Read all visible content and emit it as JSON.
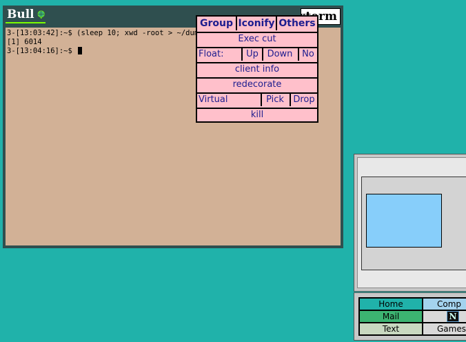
{
  "xterm": {
    "logo_text": "Bull",
    "title": "xterm",
    "lines": [
      "3-[13:03:42]:~$ (sleep 10; xwd -root > ~/dump/",
      "[1] 6014",
      "3-[13:04:16]:~$ "
    ]
  },
  "window_menu": {
    "group": "Group",
    "iconify": "Iconify",
    "others": "Others",
    "exec_cut": "Exec cut",
    "float_label": "Float:",
    "float_up": "Up",
    "float_down": "Down",
    "float_no": "No",
    "client_info": "client info",
    "redecorate": "redecorate",
    "virtual_label": "Virtual",
    "virtual_pick": "Pick",
    "virtual_drop": "Drop",
    "kill": "kill"
  },
  "panel": {
    "home": "Home",
    "comp": "Comp",
    "mail": "Mail",
    "netscape_icon": "N",
    "text": "Text",
    "games": "Games"
  },
  "colors": {
    "desktop": "#20b2aa",
    "terminal_bg": "#d2b196",
    "menu_bg": "#ffc0cb",
    "menu_text": "#1d1d8f",
    "pager_window": "#87cefa"
  }
}
